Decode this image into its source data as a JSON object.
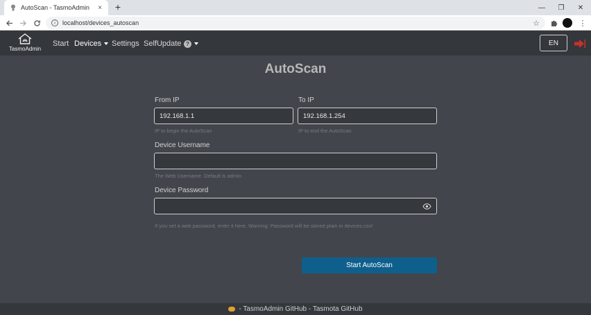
{
  "browser": {
    "tab_title": "AutoScan - TasmoAdmin",
    "tab_close": "×",
    "new_tab": "+",
    "url": "localhost/devices_autoscan",
    "minimize": "—",
    "maximize": "❐",
    "close": "✕"
  },
  "navbar": {
    "brand": "TasmoAdmin",
    "items": [
      {
        "label": "Start"
      },
      {
        "label": "Devices"
      },
      {
        "label": "Settings"
      },
      {
        "label": "SelfUpdate"
      }
    ],
    "help": "?",
    "language": "EN",
    "logout_color": "#c9302c"
  },
  "form": {
    "title": "AutoScan",
    "from_ip": {
      "label": "From IP",
      "value": "192.168.1.1",
      "hint": "IP to begin the AutoScan"
    },
    "to_ip": {
      "label": "To IP",
      "value": "192.168.1.254",
      "hint": "IP to end the AutoScan"
    },
    "username": {
      "label": "Device Username",
      "value": "",
      "hint": "The Web Username. Default is admin"
    },
    "password": {
      "label": "Device Password",
      "value": "",
      "hint": "If you set a web password, enter it here. Warning: Password will be stored plain in devices.csv!"
    },
    "submit": "Start AutoScan"
  },
  "footer": {
    "text": "- TasmoAdmin GitHub - Tasmota GitHub"
  },
  "colors": {
    "background": "#42454c",
    "navbar": "#34373c",
    "button": "#0f5f8d"
  }
}
